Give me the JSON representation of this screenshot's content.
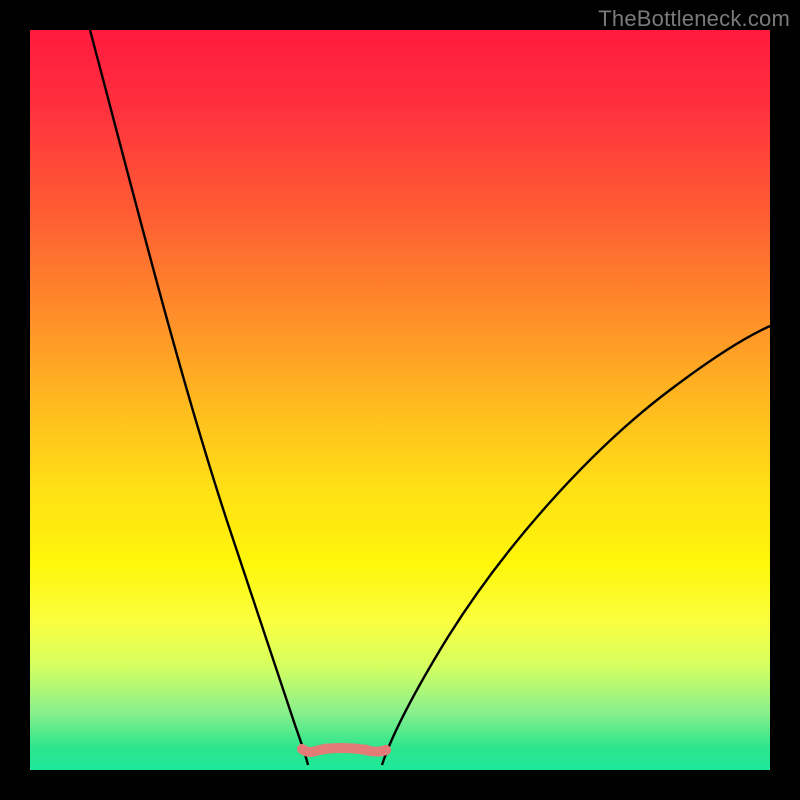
{
  "watermark": "TheBottleneck.com",
  "colors": {
    "page_bg": "#000000",
    "curve": "#000000",
    "bump": "#e37b77",
    "gradient_stops": [
      "#ff1a3e",
      "#ff2f3e",
      "#ff5a34",
      "#ff8c2a",
      "#ffb820",
      "#ffe015",
      "#fff60a",
      "#faff40",
      "#d4ff60",
      "#8cf08c",
      "#2de58c",
      "#1ee89a"
    ]
  },
  "chart_data": {
    "type": "line",
    "title": "",
    "xlabel": "",
    "ylabel": "",
    "x": [
      0.0,
      0.04,
      0.08,
      0.12,
      0.16,
      0.2,
      0.24,
      0.28,
      0.3,
      0.32,
      0.34,
      0.36,
      0.38,
      0.4,
      0.42,
      0.46,
      0.5,
      0.56,
      0.62,
      0.7,
      0.78,
      0.86,
      0.94,
      1.0
    ],
    "series": [
      {
        "name": "left-branch",
        "x": [
          0.0,
          0.04,
          0.08,
          0.12,
          0.16,
          0.2,
          0.24,
          0.28,
          0.3,
          0.32,
          0.34,
          0.36
        ],
        "values": [
          1.0,
          0.88,
          0.76,
          0.64,
          0.52,
          0.4,
          0.28,
          0.16,
          0.1,
          0.05,
          0.02,
          0.0
        ]
      },
      {
        "name": "valley-floor",
        "x": [
          0.36,
          0.38,
          0.4,
          0.42,
          0.44,
          0.46
        ],
        "values": [
          0.0,
          0.02,
          0.02,
          0.02,
          0.02,
          0.0
        ]
      },
      {
        "name": "right-branch",
        "x": [
          0.46,
          0.5,
          0.56,
          0.62,
          0.7,
          0.78,
          0.86,
          0.94,
          1.0
        ],
        "values": [
          0.0,
          0.04,
          0.12,
          0.2,
          0.3,
          0.4,
          0.48,
          0.55,
          0.6
        ]
      }
    ],
    "xlim": [
      0,
      1
    ],
    "ylim": [
      0,
      1
    ],
    "grid": false,
    "legend": false,
    "annotations": [
      {
        "text": "TheBottleneck.com",
        "pos": "top-right"
      }
    ]
  }
}
